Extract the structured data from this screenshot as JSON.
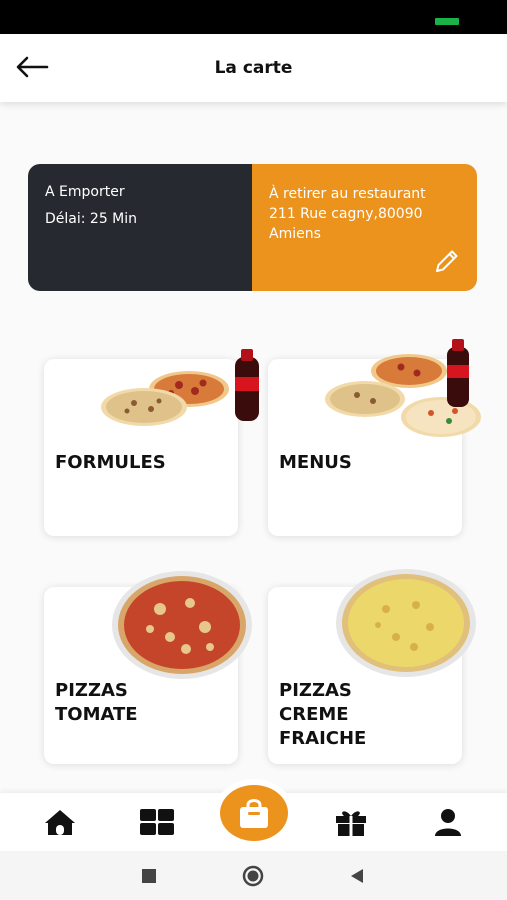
{
  "header": {
    "title": "La carte",
    "back_icon": "arrow-left-icon"
  },
  "order_info": {
    "mode": "A Emporter",
    "delay": "Délai: 25 Min",
    "pickup_line1": "À retirer au restaurant",
    "pickup_line2": "211 Rue cagny,80090",
    "pickup_line3": "Amiens",
    "edit_icon": "pencil-icon"
  },
  "categories": [
    {
      "label_line1": "FORMULES",
      "label_line2": "",
      "label_line3": ""
    },
    {
      "label_line1": "MENUS",
      "label_line2": "",
      "label_line3": ""
    },
    {
      "label_line1": "PIZZAS",
      "label_line2": "TOMATE",
      "label_line3": ""
    },
    {
      "label_line1": "PIZZAS",
      "label_line2": "CREME",
      "label_line3": "FRAICHE"
    }
  ],
  "bottom_nav": {
    "items": [
      "home-icon",
      "grid-icon",
      "shopping-bag-icon",
      "gift-icon",
      "user-icon"
    ]
  },
  "colors": {
    "accent": "#ec931e",
    "dark": "#262a30"
  }
}
